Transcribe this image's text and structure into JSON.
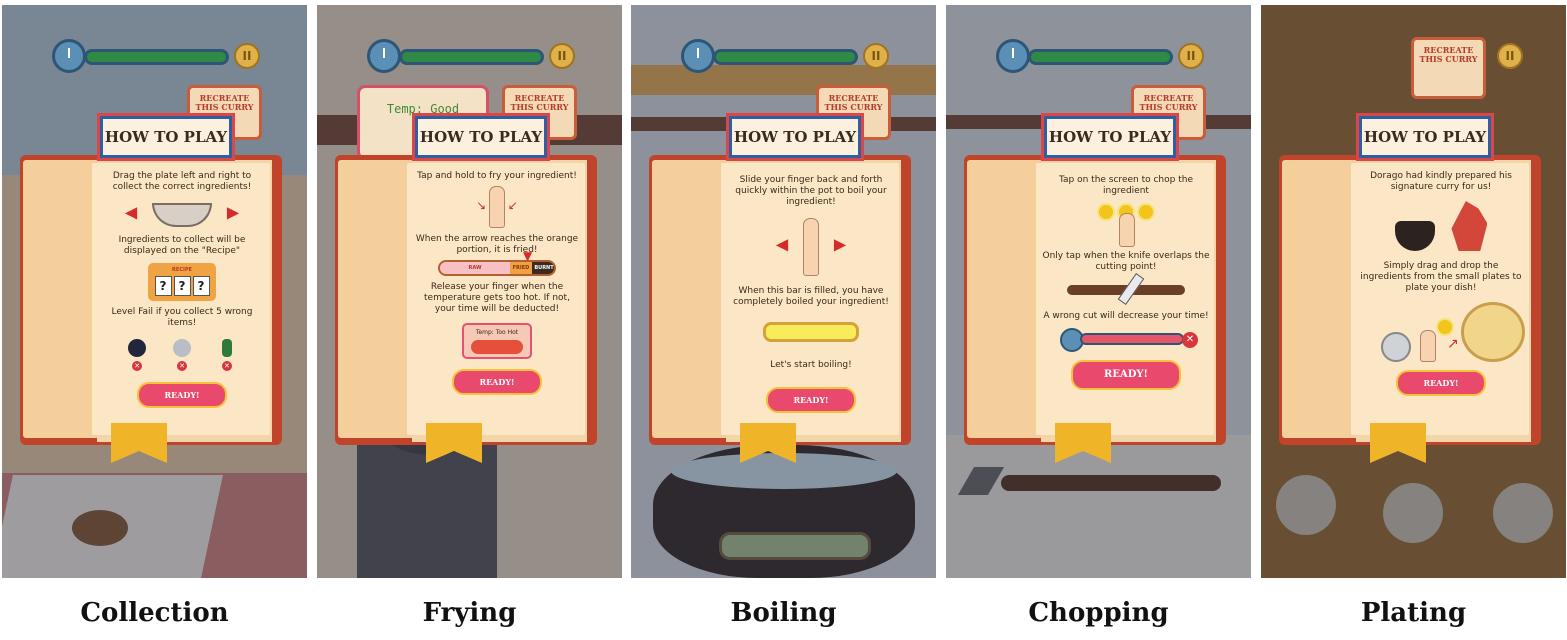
{
  "panels": [
    {
      "caption": "Collection",
      "title": "HOW TO PLAY",
      "hud_recreate": "RECREATE THIS CURRY",
      "instruction_1": "Drag the plate left and right to collect the correct ingredients!",
      "instruction_2": "Ingredients to collect will be displayed on the \"Recipe\"",
      "recipe_label": "RECIPE",
      "recipe_slots": [
        "?",
        "?",
        "?"
      ],
      "instruction_3": "Level Fail if you collect 5 wrong items!",
      "ready": "READY!"
    },
    {
      "caption": "Frying",
      "title": "HOW TO PLAY",
      "hud_temp": "Temp: Good",
      "hud_recreate": "RECREATE THIS CURRY",
      "instruction_1": "Tap and hold to fry your ingredient!",
      "instruction_2": "When the arrow reaches the orange portion, it is fried!",
      "bar_labels": [
        "RAW",
        "FRIED",
        "BURNT"
      ],
      "instruction_3": "Release your finger when the temperature gets too hot. If not, your time will be deducted!",
      "too_hot": "Temp: Too Hot",
      "ready": "READY!"
    },
    {
      "caption": "Boiling",
      "title": "HOW TO PLAY",
      "hud_recreate": "RECREATE THIS CURRY",
      "instruction_1": "Slide your finger back and forth quickly within the pot to boil your ingredient!",
      "instruction_2": "When this bar is filled, you have completely boiled your ingredient!",
      "instruction_3": "Let's start boiling!",
      "ready": "READY!"
    },
    {
      "caption": "Chopping",
      "title": "HOW TO PLAY",
      "hud_recreate": "RECREATE THIS CURRY",
      "instruction_1": "Tap on the screen to chop the ingredient",
      "instruction_2": "Only tap when the knife overlaps the cutting point!",
      "instruction_3": "A wrong cut will decrease your time!",
      "ready": "READY!"
    },
    {
      "caption": "Plating",
      "title": "HOW TO PLAY",
      "hud_recreate": "RECREATE THIS CURRY",
      "instruction_1": "Dorago had kindly prepared his signature curry for us!",
      "instruction_2": "Simply drag and drop the ingredients from the small plates to plate your dish!",
      "ready": "READY!"
    }
  ],
  "colors": {
    "ready_button": "#e8496c",
    "book_cover": "#c1432a",
    "paper": "#fbe7c6",
    "arrow": "#d72b2b"
  },
  "icons": [
    "clock-icon",
    "pause-icon",
    "bowl-icon",
    "finger-icon",
    "arrow-left-icon",
    "arrow-right-icon",
    "bomb-icon",
    "can-icon",
    "bottle-icon",
    "sunflower-icon",
    "knife-icon",
    "pot-icon",
    "dragon-icon",
    "curry-plate-icon"
  ]
}
